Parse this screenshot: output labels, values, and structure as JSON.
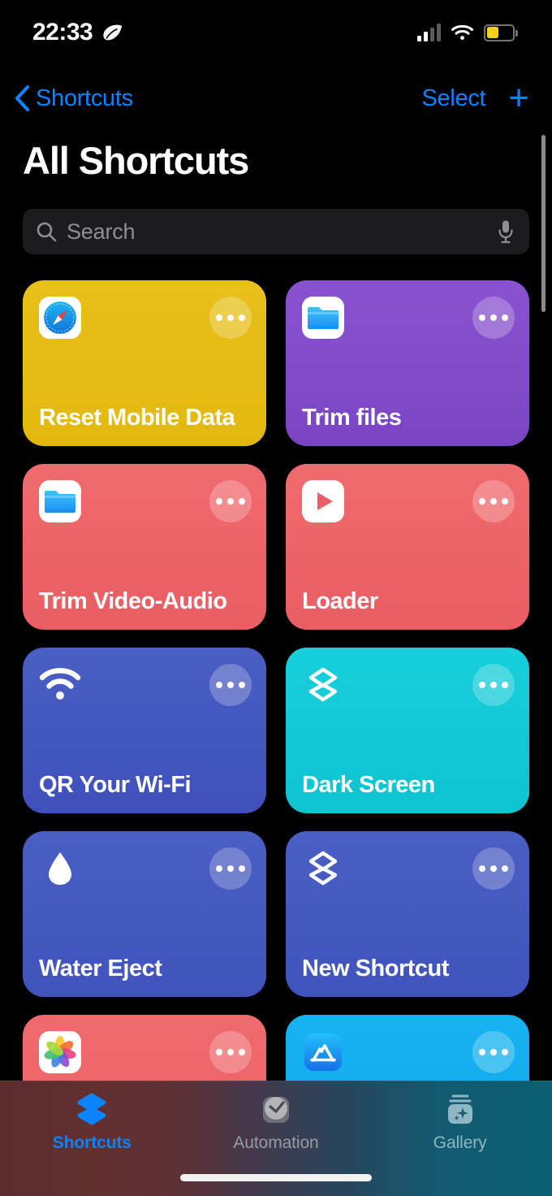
{
  "status_bar": {
    "time": "22:33",
    "leaf_icon": "leaf-icon",
    "signal_icon": "cellular-signal-icon",
    "signal_bars_filled": 2,
    "signal_bars_total": 4,
    "wifi_icon": "wifi-icon",
    "battery_icon": "battery-icon",
    "battery_color": "#f5d020",
    "battery_level_pct": 40
  },
  "nav_bar": {
    "back_icon": "chevron-left-icon",
    "back_label": "Shortcuts",
    "select_label": "Select",
    "add_label": "+",
    "accent_color": "#0a84ff"
  },
  "page_title": "All Shortcuts",
  "search": {
    "placeholder": "Search",
    "value": "",
    "search_icon": "search-icon",
    "mic_icon": "microphone-icon"
  },
  "shortcuts": [
    {
      "title": "Reset Mobile Data",
      "icon": "safari-compass-icon",
      "color_top": "#e8c01a",
      "color_bottom": "#e2b810",
      "menu_icon": "ellipsis-icon"
    },
    {
      "title": "Trim files",
      "icon": "files-folder-icon",
      "color_top": "#8a52cf",
      "color_bottom": "#7a45c4",
      "menu_icon": "ellipsis-icon"
    },
    {
      "title": "Trim Video-Audio",
      "icon": "files-folder-icon",
      "color_top": "#ef6b6e",
      "color_bottom": "#ea5d63",
      "menu_icon": "ellipsis-icon"
    },
    {
      "title": "Loader",
      "icon": "play-button-icon",
      "color_top": "#ef6b6e",
      "color_bottom": "#ea5d63",
      "menu_icon": "ellipsis-icon"
    },
    {
      "title": "QR Your Wi-Fi",
      "icon": "wifi-icon",
      "color_top": "#4a5ec4",
      "color_bottom": "#3f50bd",
      "menu_icon": "ellipsis-icon"
    },
    {
      "title": "Dark Screen",
      "icon": "shortcuts-layers-icon",
      "color_top": "#17cfda",
      "color_bottom": "#0fc3d1",
      "menu_icon": "ellipsis-icon"
    },
    {
      "title": "Water Eject",
      "icon": "water-droplet-icon",
      "color_top": "#4a5ec4",
      "color_bottom": "#4154bd",
      "menu_icon": "ellipsis-icon"
    },
    {
      "title": "New Shortcut",
      "icon": "shortcuts-layers-icon",
      "color_top": "#4a5ec4",
      "color_bottom": "#4154bd",
      "menu_icon": "ellipsis-icon"
    },
    {
      "title": "",
      "icon": "photos-app-icon",
      "color_top": "#ef6b6e",
      "color_bottom": "#ea5d63",
      "menu_icon": "ellipsis-icon"
    },
    {
      "title": "",
      "icon": "app-store-icon",
      "color_top": "#16b2f0",
      "color_bottom": "#10a8ec",
      "menu_icon": "ellipsis-icon"
    }
  ],
  "tab_bar": {
    "tabs": [
      {
        "label": "Shortcuts",
        "icon": "shortcuts-layers-icon",
        "active": true
      },
      {
        "label": "Automation",
        "icon": "automation-clock-icon",
        "active": false
      },
      {
        "label": "Gallery",
        "icon": "gallery-sparkle-icon",
        "active": false
      }
    ],
    "active_color": "#0a84ff"
  }
}
